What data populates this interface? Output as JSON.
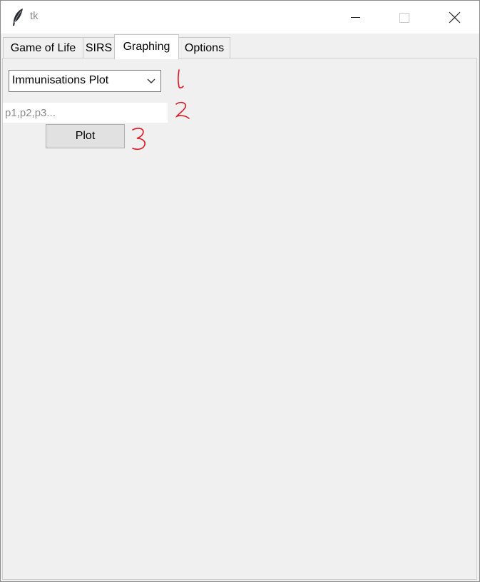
{
  "window": {
    "title": "tk",
    "icons": [
      "feather-icon",
      "minimize-icon",
      "maximize-icon",
      "close-icon"
    ]
  },
  "tabs": [
    {
      "label": "Game of Life",
      "active": false
    },
    {
      "label": "SIRS",
      "active": false
    },
    {
      "label": "Graphing",
      "active": true
    },
    {
      "label": "Options",
      "active": false
    }
  ],
  "graphing": {
    "plot_type": {
      "selected": "Immunisations Plot",
      "icon": "chevron-down-icon"
    },
    "params_input": {
      "value": "",
      "placeholder": "p1,p2,p3..."
    },
    "plot_button": "Plot"
  },
  "colors": {
    "background": "#f0f0f0",
    "titlebar": "#ffffff",
    "annotation": "#e0141e"
  }
}
